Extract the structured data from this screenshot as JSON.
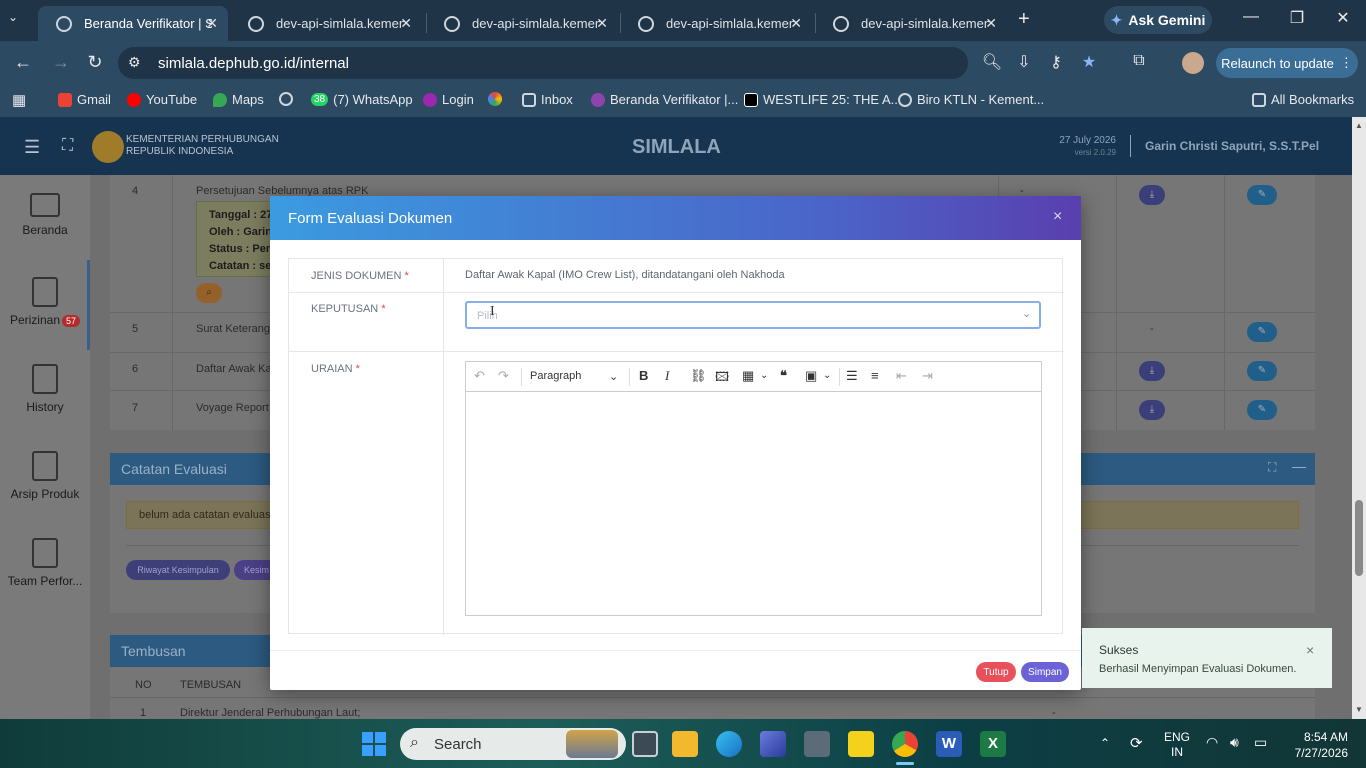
{
  "browser": {
    "tabs": [
      {
        "title": "Beranda Verifikator | Si",
        "active": true
      },
      {
        "title": "dev-api-simlala.kemenh",
        "active": false
      },
      {
        "title": "dev-api-simlala.kemenh",
        "active": false
      },
      {
        "title": "dev-api-simlala.kemenh",
        "active": false
      },
      {
        "title": "dev-api-simlala.kemenh",
        "active": false
      }
    ],
    "gemini_label": "Ask Gemini",
    "url": "simlala.dephub.go.id/internal",
    "relaunch_label": "Relaunch to update",
    "bookmarks": [
      "Gmail",
      "YouTube",
      "Maps",
      "(7) WhatsApp",
      "Login",
      "Inbox",
      "Beranda Verifikator |...",
      "WESTLIFE 25: THE A...",
      "Biro KTLN - Kement..."
    ],
    "whatsapp_count": "38",
    "all_bookmarks": "All Bookmarks"
  },
  "app": {
    "org_line1": "KEMENTERIAN PERHUBUNGAN",
    "org_line2": "REPUBLIK INDONESIA",
    "name": "SIMLALA",
    "date": "27 July 2026",
    "version": "versi 2.0.29",
    "user": "Garin Christi Saputri, S.S.T.Pel"
  },
  "sidebar": {
    "items": [
      {
        "label": "Beranda"
      },
      {
        "label": "Perizinan",
        "badge": "57"
      },
      {
        "label": "History"
      },
      {
        "label": "Arsip Produk"
      },
      {
        "label": "Team Perfor..."
      }
    ]
  },
  "background": {
    "rows": [
      {
        "no": "4",
        "name": "Persetujuan Sebelumnya atas RPK",
        "dash": "-"
      },
      {
        "no": "5",
        "name": "Surat Keterangan",
        "dash": "-"
      },
      {
        "no": "6",
        "name": "Daftar Awak Kap",
        "dash": ""
      },
      {
        "no": "7",
        "name": "Voyage Report (",
        "dash": ""
      }
    ],
    "row4_details": {
      "tanggal": "Tanggal : 27",
      "oleh": "Oleh : Garin",
      "status": "Status : Pers",
      "catatan": "Catatan : ses"
    },
    "catatan_title": "Catatan Evaluasi",
    "catatan_empty": "belum ada catatan evaluasi",
    "btn_riwayat": "Riwayat Kesimpulan",
    "btn_kesim": "Kesim",
    "tembusan_title": "Tembusan",
    "tembusan_cols": [
      "NO",
      "TEMBUSAN"
    ],
    "tembusan_row": {
      "no": "1",
      "text": "Direktur Jenderal Perhubungan Laut;",
      "dash": "-"
    }
  },
  "modal": {
    "title": "Form Evaluasi Dokumen",
    "close": "×",
    "jenis_label": "JENIS DOKUMEN",
    "jenis_value": "Daftar Awak Kapal (IMO Crew List), ditandatangani oleh Nakhoda",
    "keputusan_label": "KEPUTUSAN",
    "keputusan_placeholder": "Pilih",
    "uraian_label": "URAIAN",
    "required_mark": "*",
    "editor_paragraph": "Paragraph",
    "btn_tutup": "Tutup",
    "btn_simpan": "Simpan"
  },
  "toast": {
    "title": "Sukses",
    "message": "Berhasil Menyimpan Evaluasi Dokumen.",
    "close": "×"
  },
  "taskbar": {
    "search_label": "Search",
    "lang1": "ENG",
    "lang2": "IN",
    "time": "8:54 AM",
    "date": "7/27/2026"
  }
}
